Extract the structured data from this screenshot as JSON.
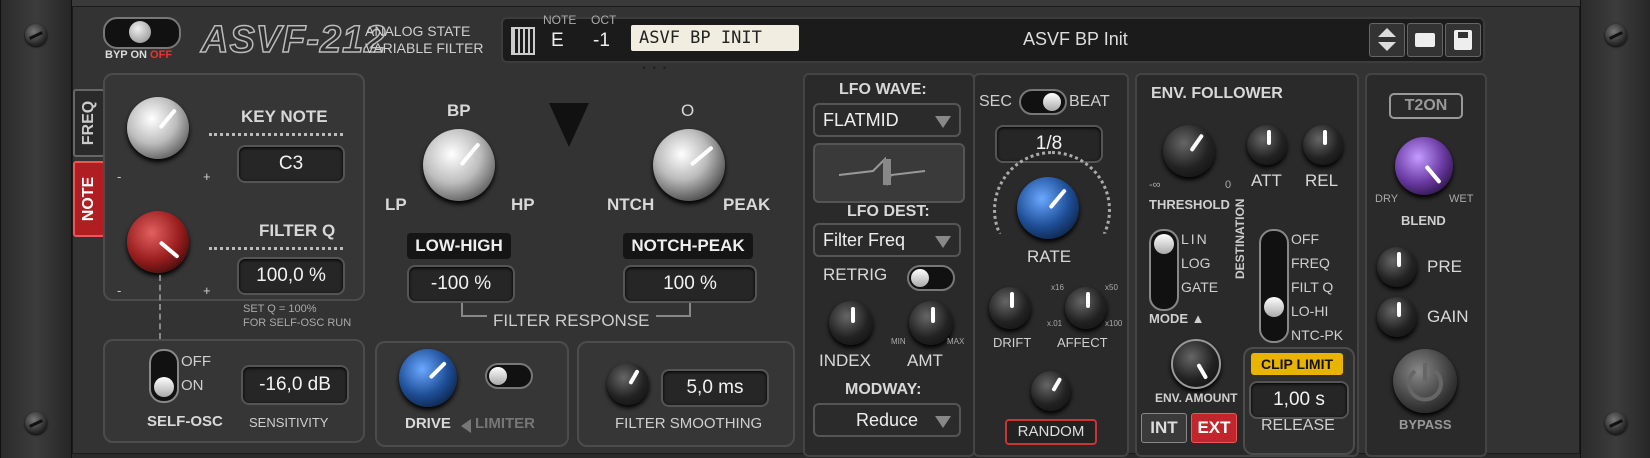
{
  "header": {
    "bypass_switch": {
      "byp": "BYP",
      "on": "ON",
      "off": "OFF"
    },
    "logo": "ASVF-212",
    "subtitle_line1": "ANALOG STATE",
    "subtitle_line2": "VARIABLE FILTER",
    "note_label": "NOTE",
    "oct_label": "OCT",
    "note_value": "E",
    "oct_value": "-1",
    "patch_tag": "ASVF BP INIT ...",
    "patch_name": "ASVF BP Init"
  },
  "tabs": {
    "freq": "FREQ",
    "note": "NOTE"
  },
  "keynote": {
    "label": "KEY NOTE",
    "value": "C3",
    "minus": "-",
    "plus": "+"
  },
  "filterq": {
    "label": "FILTER Q",
    "value": "100,0 %",
    "minus": "-",
    "plus": "+",
    "hint_line1": "SET Q = 100%",
    "hint_line2": "FOR SELF-OSC RUN"
  },
  "selfosc": {
    "off": "OFF",
    "on": "ON",
    "label": "SELF-OSC",
    "sensitivity_value": "-16,0 dB",
    "sensitivity_label": "SENSITIVITY"
  },
  "filter_response": {
    "bp": "BP",
    "lp": "LP",
    "hp": "HP",
    "o": "O",
    "ntch": "NTCH",
    "peak": "PEAK",
    "low_high_label": "LOW-HIGH",
    "low_high_value": "-100 %",
    "notch_peak_label": "NOTCH-PEAK",
    "notch_peak_value": "100 %",
    "section_label": "FILTER RESPONSE"
  },
  "drive": {
    "label": "DRIVE",
    "limiter": "LIMITER"
  },
  "smoothing": {
    "value": "5,0 ms",
    "label": "FILTER SMOOTHING"
  },
  "lfo": {
    "wave_label": "LFO WAVE:",
    "wave_value": "FLATMID",
    "dest_label": "LFO DEST:",
    "dest_value": "Filter Freq",
    "retrig": "RETRIG",
    "index": "INDEX",
    "amt": "AMT",
    "amt_min": "MIN",
    "amt_max": "MAX",
    "modway_label": "MODWAY:",
    "modway_value": "Reduce",
    "sec": "SEC",
    "beat": "BEAT",
    "rate_value": "1/8",
    "rate_label": "RATE",
    "drift": "DRIFT",
    "affect": "AFFECT",
    "x16": "x16",
    "x50": "x50",
    "x01": "x.01",
    "x100": "x100",
    "random": "RANDOM"
  },
  "env": {
    "title": "ENV. FOLLOWER",
    "threshold": "THRESHOLD",
    "th_min": "-∞",
    "th_max": "0",
    "att": "ATT",
    "rel": "REL",
    "mode_lin": "LIN",
    "mode_log": "LOG",
    "mode_gate": "GATE",
    "mode_label": "MODE ▲",
    "destination": "DESTINATION",
    "dest_off": "OFF",
    "dest_freq": "FREQ",
    "dest_filtq": "FILT Q",
    "dest_lohi": "LO-HI",
    "dest_ntcpk": "NTC-PK",
    "env_amount": "ENV. AMOUNT",
    "int": "INT",
    "ext": "EXT",
    "clip_limit": "CLIP LIMIT",
    "release_value": "1,00 s",
    "release_label": "RELEASE"
  },
  "output": {
    "brand": "T2ON",
    "dry": "DRY",
    "wet": "WET",
    "blend": "BLEND",
    "pre": "PRE",
    "gain": "GAIN",
    "bypass": "BYPASS"
  },
  "colors": {
    "accent_red": "#c0262b",
    "clip_yellow": "#e8b400",
    "blue_knob": "#2f6fd0"
  }
}
